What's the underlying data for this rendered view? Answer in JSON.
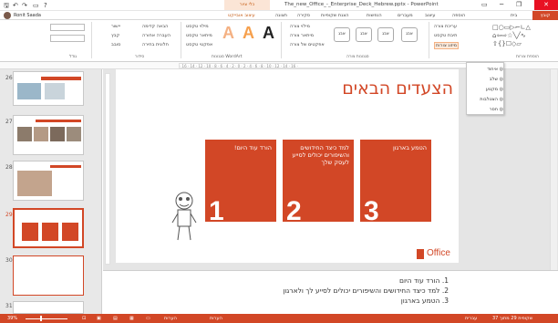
{
  "window": {
    "title": "The_new_Office_-_Enterprise_Deck_Hebrew.pptx - PowerPoint",
    "context_tab_group": "כלי ציור",
    "user": "Ronit Saada"
  },
  "tabs": [
    "קובץ",
    "בית",
    "הוספה",
    "עיצוב",
    "מעברים",
    "הנפשות",
    "הצגת שקופיות",
    "סקירה",
    "תצוגה",
    "עיצוב אובייקט"
  ],
  "ribbon": {
    "shape_fill": "מילוי צורה",
    "shape_outline": "מיתאר צורה",
    "shape_effects": "אפקטים של צורה",
    "text_fill": "מילוי טקסט",
    "text_outline": "מיתאר טקסט",
    "text_effects": "אפקטי טקסט",
    "bring_forward": "הבאה קדימה",
    "send_backward": "העברה אחורה",
    "selection_pane": "חלונית בחירה",
    "align": "יישור",
    "group": "קבץ",
    "rotate": "סובב",
    "style_sample": "אבג",
    "edit_shape": "עריכת צורה",
    "text_box": "תיבת טקסט",
    "merge_shapes": "מיזוג צורות",
    "group_labels": {
      "insert_shapes": "הוספת צורות",
      "shape_styles": "סגנונות צורה",
      "wordart_styles": "סגנונות WordArt",
      "arrange": "סידור",
      "size": "גודל"
    }
  },
  "merge_menu": [
    "איחוד",
    "שלב",
    "מקטע",
    "הצטלבות",
    "חסר"
  ],
  "thumbnails": [
    {
      "num": "26"
    },
    {
      "num": "27"
    },
    {
      "num": "28"
    },
    {
      "num": "29"
    },
    {
      "num": "30",
      "label": "Office"
    },
    {
      "num": "31"
    }
  ],
  "slide": {
    "title": "הצעדים הבאים",
    "boxes": [
      {
        "text": "הורד עוד היום!",
        "num": "1"
      },
      {
        "text": "למד כיצד החידושים והשיפורים יכולים לסייע לעסק שלך",
        "num": "2"
      },
      {
        "text": "הטמע בארגון",
        "num": "3"
      }
    ],
    "logo_text": "Office"
  },
  "notes": [
    "1. הורד עוד היום",
    "2. למד כיצד החידושים והשיפורים יכולים לסייע לך ולארגון",
    "3. הטמע בארגון"
  ],
  "status": {
    "slide_info": "שקופית 29 מתוך 37",
    "language": "עברית",
    "notes": "הערות",
    "comments": "הערות",
    "zoom": "39%"
  },
  "colors": {
    "accent": "#d24726"
  }
}
